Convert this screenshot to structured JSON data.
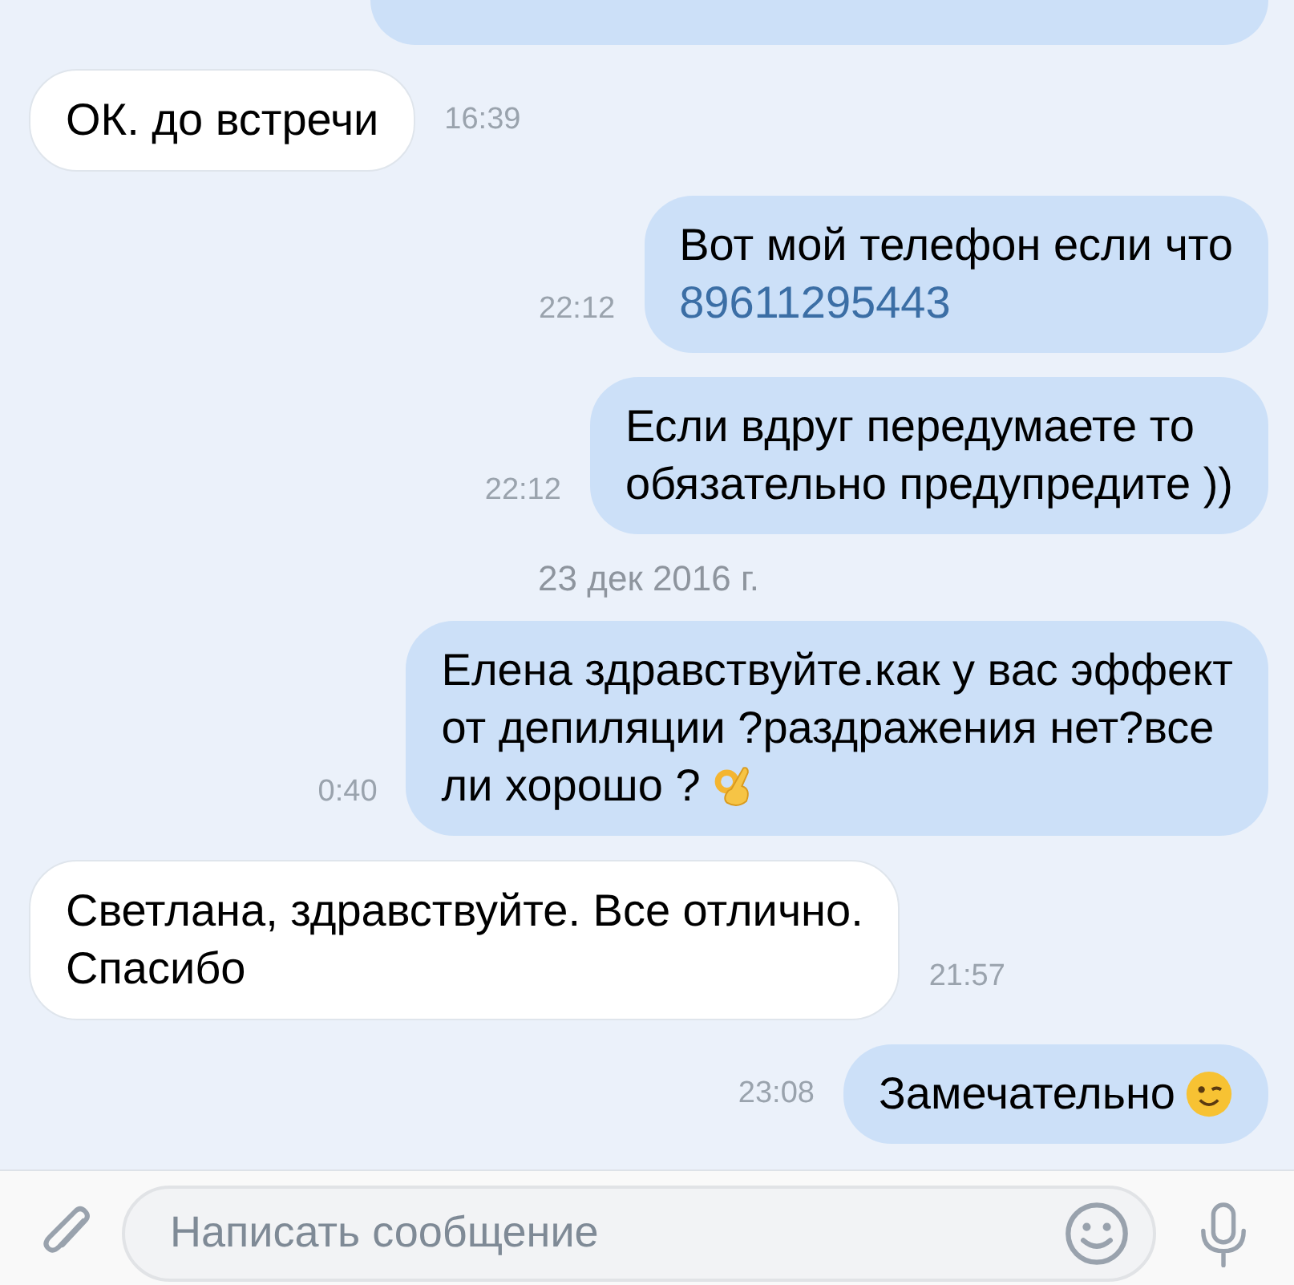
{
  "items": [
    {
      "kind": "clipped-outgoing"
    },
    {
      "kind": "incoming",
      "lines": [
        "ОК. до встречи"
      ],
      "time": "16:39"
    },
    {
      "kind": "outgoing",
      "lines": [
        "Вот мой телефон если что"
      ],
      "link": "89611295443",
      "time": "22:12"
    },
    {
      "kind": "outgoing",
      "lines": [
        "Если вдруг передумаете то",
        "обязательно предупредите ))"
      ],
      "time": "22:12"
    },
    {
      "kind": "date",
      "text": "23 дек 2016 г."
    },
    {
      "kind": "outgoing",
      "lines": [
        "Елена здравствуйте.как у вас эффект",
        "от депиляции ?раздражения нет?все",
        "ли хорошо ?"
      ],
      "emoji": {
        "kind": "ok-hand"
      },
      "time": "0:40"
    },
    {
      "kind": "incoming",
      "lines": [
        "Светлана, здравствуйте. Все отлично.",
        "Спасибо"
      ],
      "time": "21:57"
    },
    {
      "kind": "outgoing",
      "lines": [
        "Замечательно"
      ],
      "emoji": {
        "kind": "wink"
      },
      "time": "23:08"
    }
  ],
  "composer": {
    "placeholder": "Написать сообщение"
  }
}
